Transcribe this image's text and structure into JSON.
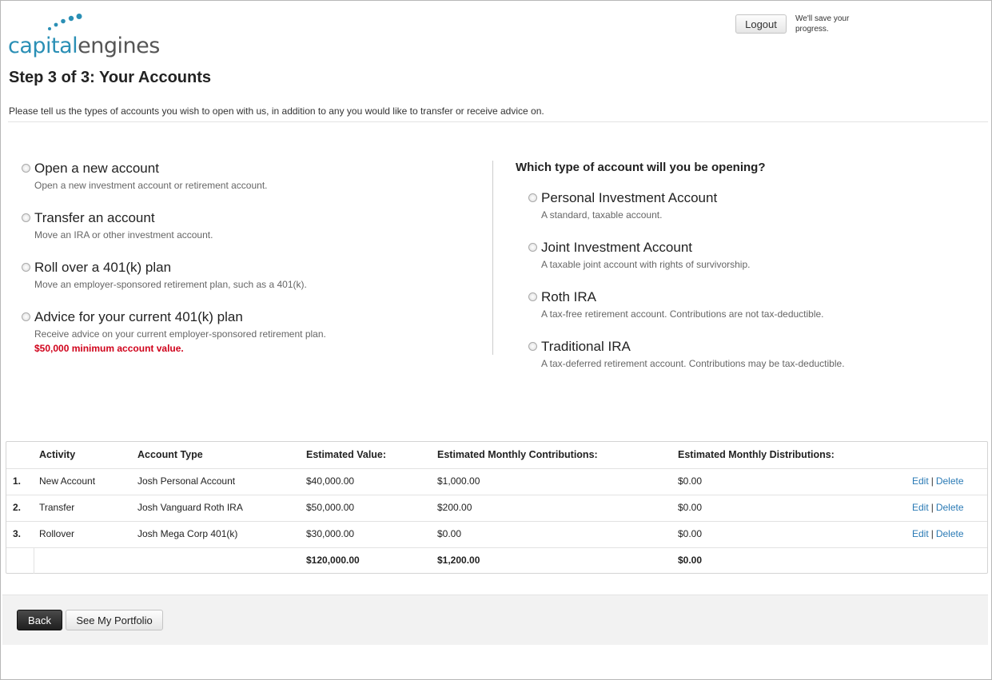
{
  "header": {
    "logo_part1": "capital",
    "logo_part2": "engines",
    "logout_label": "Logout",
    "save_note": "We'll save your progress."
  },
  "page": {
    "title": "Step 3 of 3: Your Accounts",
    "intro": "Please tell us the types of accounts you wish to open with us, in addition to any you would like to transfer or receive advice on."
  },
  "activity_options": [
    {
      "title": "Open a new account",
      "desc": "Open a new investment account or retirement account."
    },
    {
      "title": "Transfer an account",
      "desc": "Move an IRA or other investment account."
    },
    {
      "title": "Roll over a 401(k) plan",
      "desc": "Move an employer-sponsored retirement plan, such as a 401(k)."
    },
    {
      "title": "Advice for your current 401(k) plan",
      "desc": "Receive advice on your current employer-sponsored retirement plan.",
      "warning": "$50,000 minimum account value."
    }
  ],
  "account_type": {
    "question": "Which type of account will you be opening?",
    "options": [
      {
        "title": "Personal Investment Account",
        "desc": "A standard, taxable account."
      },
      {
        "title": "Joint Investment Account",
        "desc": "A taxable joint account with rights of survivorship."
      },
      {
        "title": "Roth IRA",
        "desc": "A tax-free retirement account. Contributions are not tax-deductible."
      },
      {
        "title": "Traditional IRA",
        "desc": "A tax-deferred retirement account. Contributions may be tax-deductible."
      }
    ]
  },
  "table": {
    "headers": {
      "activity": "Activity",
      "account_type": "Account Type",
      "value": "Estimated Value:",
      "contrib": "Estimated Monthly Contributions:",
      "dist": "Estimated Monthly Distributions:"
    },
    "rows": [
      {
        "num": "1.",
        "activity": "New Account",
        "account_type": "Josh Personal Account",
        "value": "$40,000.00",
        "contrib": "$1,000.00",
        "dist": "$0.00"
      },
      {
        "num": "2.",
        "activity": "Transfer",
        "account_type": "Josh Vanguard Roth IRA",
        "value": "$50,000.00",
        "contrib": "$200.00",
        "dist": "$0.00"
      },
      {
        "num": "3.",
        "activity": "Rollover",
        "account_type": "Josh Mega Corp 401(k)",
        "value": "$30,000.00",
        "contrib": "$0.00",
        "dist": "$0.00"
      }
    ],
    "edit_label": "Edit",
    "separator": "|",
    "delete_label": "Delete",
    "totals": {
      "value": "$120,000.00",
      "contrib": "$1,200.00",
      "dist": "$0.00"
    }
  },
  "footer": {
    "back_label": "Back",
    "portfolio_label": "See My Portfolio"
  },
  "colors": {
    "brand_blue": "#2a8fb5",
    "link": "#2a7ab5",
    "warning": "#d0021b"
  }
}
